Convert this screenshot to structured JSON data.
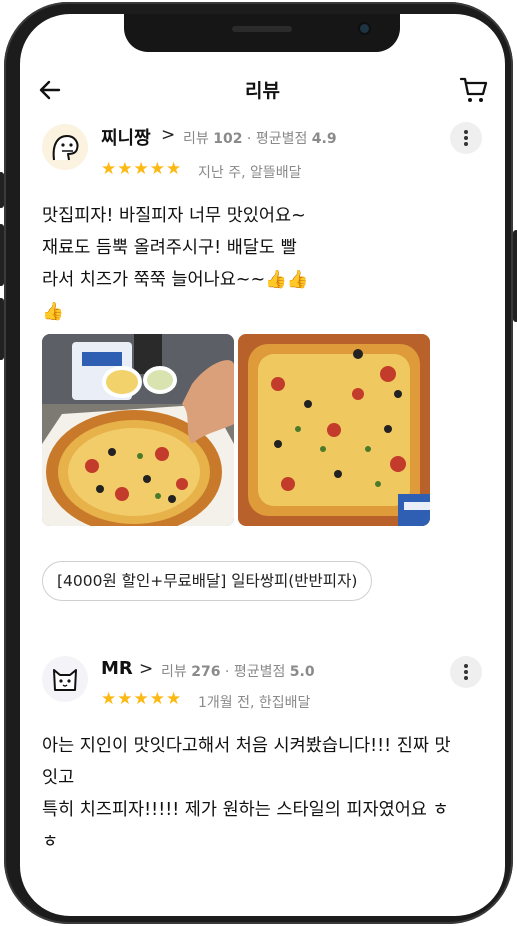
{
  "header": {
    "title": "리뷰"
  },
  "reviews": [
    {
      "nickname": "찌니짱",
      "review_count_label": "리뷰",
      "review_count": "102",
      "avg_label": "평균별점",
      "avg_rating": "4.9",
      "stars": "★★★★★",
      "rating": 5,
      "when": "지난 주, 알뜰배달",
      "lines": [
        "맛집피자! 바질피자 너무 맛있어요~",
        "재료도 듬뿍 올려주시구! 배달도 빨",
        "라서 치즈가 쭉쭉 늘어나요~~👍👍",
        "👍"
      ],
      "menu": "[4000원 할인+무료배달] 일타쌍피(반반피자)"
    },
    {
      "nickname": "MR",
      "review_count_label": "리뷰",
      "review_count": "276",
      "avg_label": "평균별점",
      "avg_rating": "5.0",
      "stars": "★★★★★",
      "rating": 5,
      "when": "1개월 전, 한집배달",
      "lines": [
        "아는 지인이 맛잇다고해서 처음 시켜봤습니다!!! 진짜 맛",
        "잇고",
        "특히 치즈피자!!!!! 제가 원하는 스타일의 피자였어요 ㅎ",
        "ㅎ"
      ]
    }
  ],
  "icons": {
    "back": "arrow-left-icon",
    "cart": "cart-icon",
    "more": "more-vertical-icon"
  },
  "colors": {
    "star": "#fdb913",
    "meta": "#8a8a8a"
  }
}
